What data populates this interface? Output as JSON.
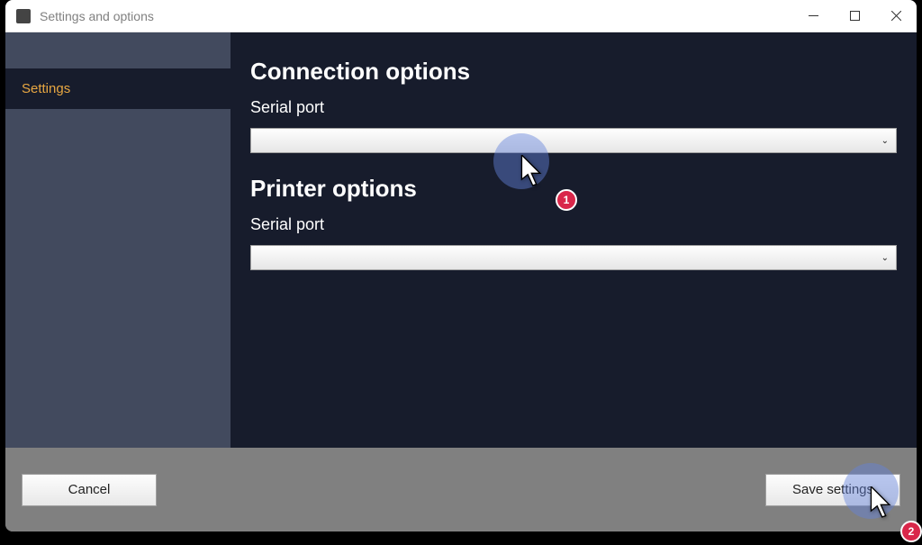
{
  "window": {
    "title": "Settings and options"
  },
  "sidebar": {
    "items": [
      {
        "label": "Settings"
      }
    ]
  },
  "main": {
    "sections": [
      {
        "heading": "Connection options",
        "field_label": "Serial port",
        "dropdown_value": ""
      },
      {
        "heading": "Printer options",
        "field_label": "Serial port",
        "dropdown_value": ""
      }
    ]
  },
  "footer": {
    "cancel_label": "Cancel",
    "save_label": "Save settings"
  },
  "annotations": {
    "badge1": "1",
    "badge2": "2"
  }
}
